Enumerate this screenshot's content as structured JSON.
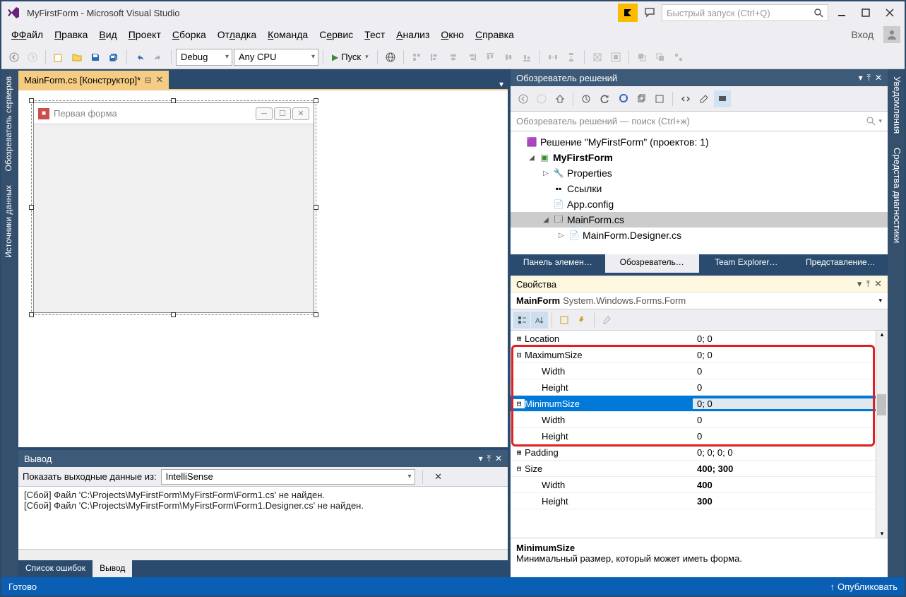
{
  "title": "MyFirstForm - Microsoft Visual Studio",
  "quick_launch_placeholder": "Быстрый запуск (Ctrl+Q)",
  "menu": {
    "file": "Файл",
    "edit": "Правка",
    "view": "Вид",
    "project": "Проект",
    "build": "Сборка",
    "debug": "Отладка",
    "team": "Команда",
    "services": "Сервис",
    "test": "Тест",
    "analyze": "Анализ",
    "window": "Окно",
    "help": "Справка",
    "login": "Вход"
  },
  "toolbar": {
    "config": "Debug",
    "platform": "Any CPU",
    "start": "Пуск"
  },
  "left_tabs": {
    "server_explorer": "Обозреватель серверов",
    "data_sources": "Источники данных"
  },
  "right_tabs": {
    "notifications": "Уведомления",
    "diagnostics": "Средства диагностики"
  },
  "doc_tab": "MainForm.cs [Конструктор]*",
  "form_title": "Первая форма",
  "output": {
    "title": "Вывод",
    "show_label": "Показать выходные данные из:",
    "source": "IntelliSense",
    "line1": "[Сбой] Файл 'C:\\Projects\\MyFirstForm\\MyFirstForm\\Form1.cs' не найден.",
    "line2": "[Сбой] Файл 'C:\\Projects\\MyFirstForm\\MyFirstForm\\Form1.Designer.cs' не найден."
  },
  "bottom_tabs": {
    "errors": "Список ошибок",
    "output": "Вывод"
  },
  "sol": {
    "title": "Обозреватель решений",
    "search": "Обозреватель решений — поиск (Ctrl+ж)",
    "solution": "Решение \"MyFirstForm\"  (проектов: 1)",
    "project": "MyFirstForm",
    "properties": "Properties",
    "references": "Ссылки",
    "appconfig": "App.config",
    "mainform": "MainForm.cs",
    "designer": "MainForm.Designer.cs"
  },
  "sol_tabs": {
    "toolbox": "Панель элемен…",
    "sol": "Обозреватель…",
    "team": "Team Explorer…",
    "class": "Представление…"
  },
  "props": {
    "title": "Свойства",
    "object_name": "MainForm",
    "object_type": "System.Windows.Forms.Form",
    "rows": {
      "location": {
        "name": "Location",
        "val": "0; 0"
      },
      "maxsize": {
        "name": "MaximumSize",
        "val": "0; 0"
      },
      "max_w": {
        "name": "Width",
        "val": "0"
      },
      "max_h": {
        "name": "Height",
        "val": "0"
      },
      "minsize": {
        "name": "MinimumSize",
        "val": "0; 0"
      },
      "min_w": {
        "name": "Width",
        "val": "0"
      },
      "min_h": {
        "name": "Height",
        "val": "0"
      },
      "padding": {
        "name": "Padding",
        "val": "0; 0; 0; 0"
      },
      "size": {
        "name": "Size",
        "val": "400; 300"
      },
      "size_w": {
        "name": "Width",
        "val": "400"
      },
      "size_h": {
        "name": "Height",
        "val": "300"
      }
    },
    "desc_title": "MinimumSize",
    "desc_text": "Минимальный размер, который может иметь форма."
  },
  "status": {
    "ready": "Готово",
    "publish": "Опубликовать"
  }
}
